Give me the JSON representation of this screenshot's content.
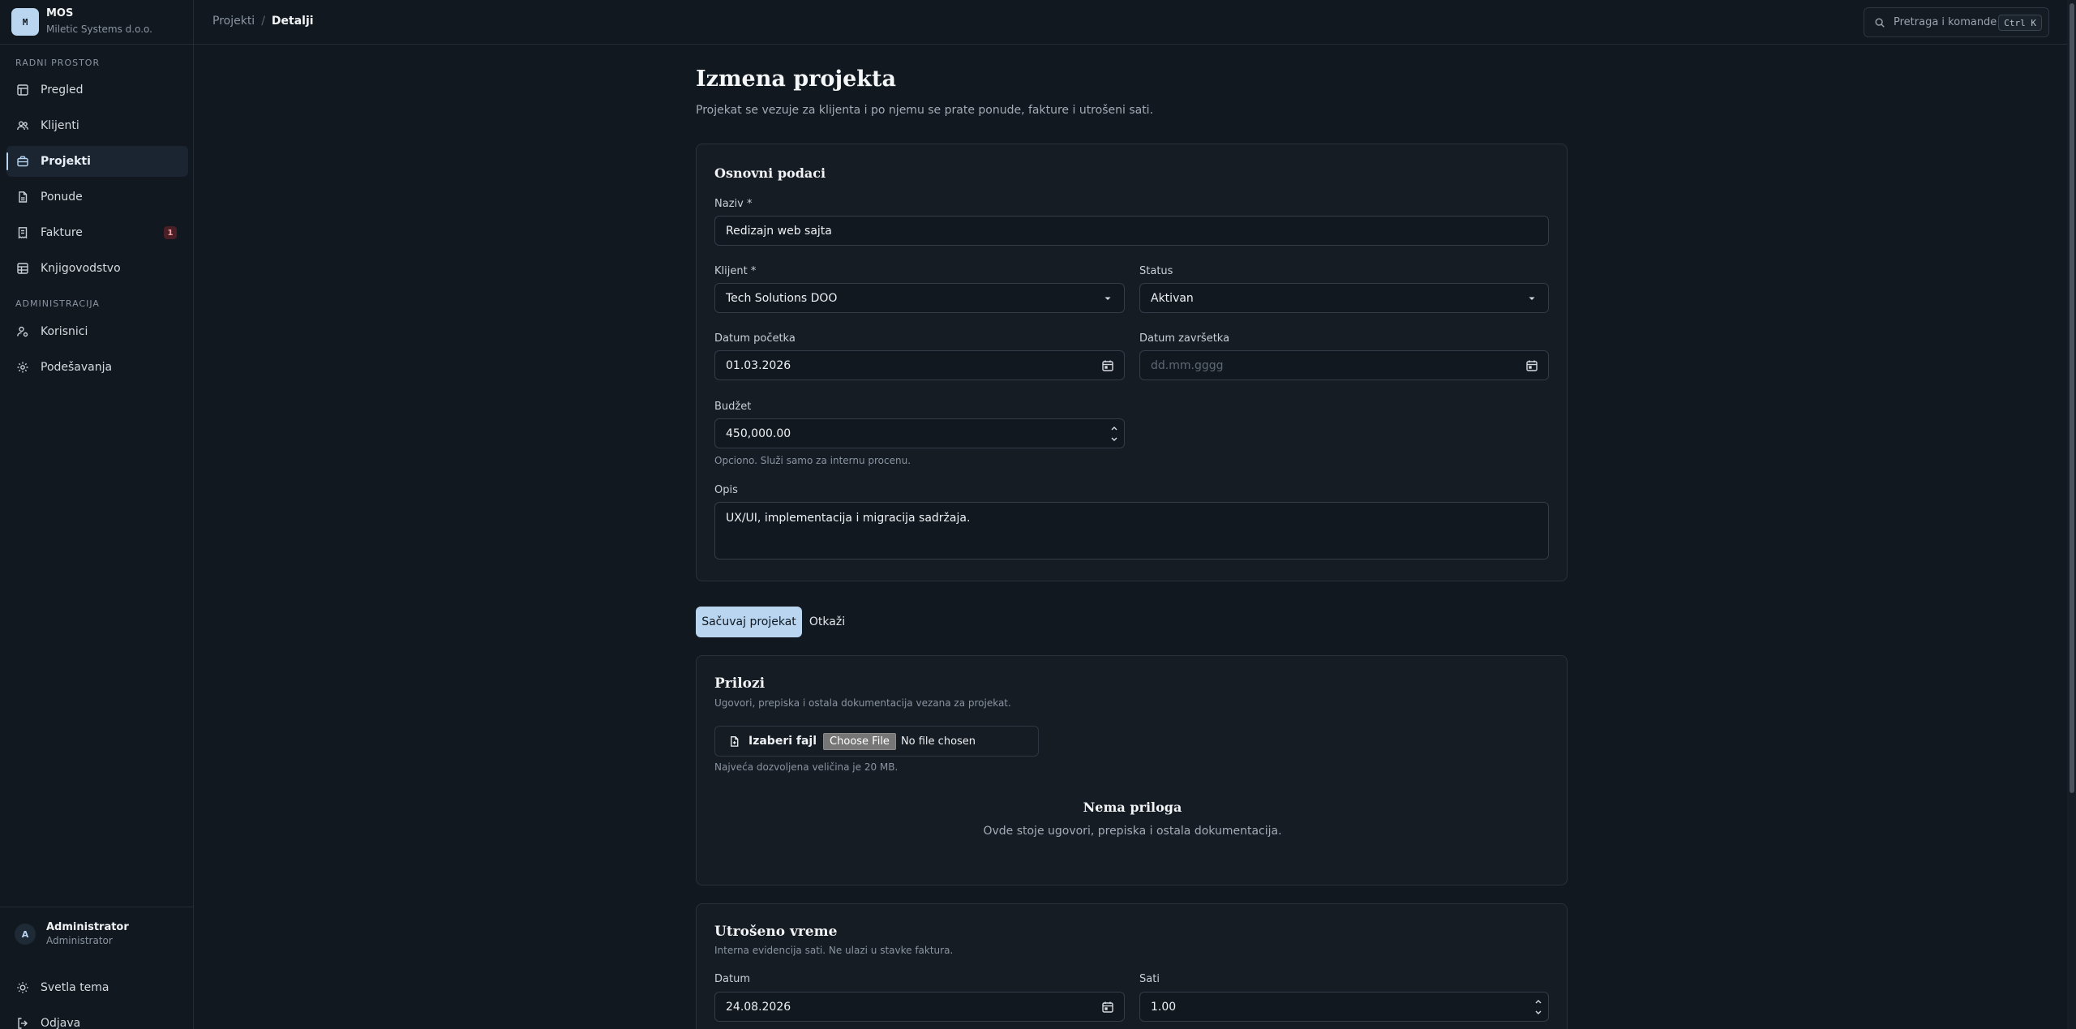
{
  "brand": {
    "logo": "M",
    "name": "MOS",
    "company": "Miletic Systems d.o.o."
  },
  "sidebar": {
    "section_workspace": "RADNI PROSTOR",
    "section_admin": "ADMINISTRACIJA",
    "items": [
      {
        "label": "Pregled",
        "icon": "layout-icon"
      },
      {
        "label": "Klijenti",
        "icon": "users-icon"
      },
      {
        "label": "Projekti",
        "icon": "briefcase-icon",
        "active": true
      },
      {
        "label": "Ponude",
        "icon": "document-icon"
      },
      {
        "label": "Fakture",
        "icon": "receipt-icon",
        "badge": "1"
      },
      {
        "label": "Knjigovodstvo",
        "icon": "table-icon"
      }
    ],
    "admin_items": [
      {
        "label": "Korisnici",
        "icon": "user-gear-icon"
      },
      {
        "label": "Podešavanja",
        "icon": "gear-icon"
      }
    ],
    "user": {
      "initial": "A",
      "name": "Administrator",
      "role": "Administrator"
    },
    "theme_label": "Svetla tema",
    "logout_label": "Odjava"
  },
  "topbar": {
    "breadcrumb_parent": "Projekti",
    "breadcrumb_sep": "/",
    "breadcrumb_current": "Detalji",
    "search_placeholder": "Pretraga i komande",
    "search_shortcut": "Ctrl K"
  },
  "page": {
    "title": "Izmena projekta",
    "subtitle": "Projekat se vezuje za klijenta i po njemu se prate ponude, fakture i utrošeni sati."
  },
  "basic": {
    "title": "Osnovni podaci",
    "name_label": "Naziv *",
    "name_value": "Redizajn web sajta",
    "client_label": "Klijent *",
    "client_value": "Tech Solutions DOO",
    "status_label": "Status",
    "status_value": "Aktivan",
    "start_label": "Datum početka",
    "start_value": "01.03.2026",
    "end_label": "Datum završetka",
    "end_placeholder": "dd.mm.gggg",
    "budget_label": "Budžet",
    "budget_value": "450,000.00",
    "budget_hint": "Opciono. Služi samo za internu procenu.",
    "desc_label": "Opis",
    "desc_value": "UX/UI, implementacija i migracija sadržaja."
  },
  "actions": {
    "save": "Sačuvaj projekat",
    "cancel": "Otkaži"
  },
  "attachments": {
    "title": "Prilozi",
    "subtitle": "Ugovori, prepiska i ostala dokumentacija vezana za projekat.",
    "pick_label": "Izaberi fajl",
    "choose_button": "Choose File",
    "no_file": "No file chosen",
    "max_size": "Najveća dozvoljena veličina je 20 MB.",
    "empty_title": "Nema priloga",
    "empty_sub": "Ovde stoje ugovori, prepiska i ostala dokumentacija."
  },
  "time": {
    "title": "Utrošeno vreme",
    "subtitle": "Interna evidencija sati. Ne ulazi u stavke faktura.",
    "date_label": "Datum",
    "date_value": "24.08.2026",
    "hours_label": "Sati",
    "hours_value": "1.00"
  },
  "colors": {
    "accent": "#b9d5f0",
    "background": "#111820",
    "card": "#151c24",
    "badge": "#4a1f26"
  }
}
